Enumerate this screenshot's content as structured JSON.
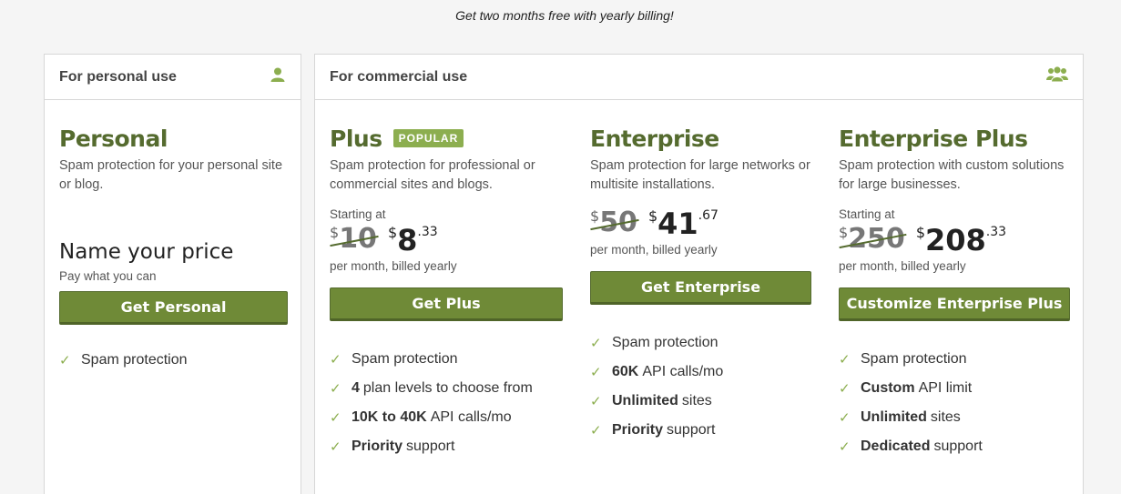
{
  "promo": "Get two months free with yearly billing!",
  "personal_panel": {
    "title": "For personal use",
    "icon": "user-icon",
    "plan": {
      "name": "Personal",
      "description": "Spam protection for your personal site or blog.",
      "price_title": "Name your price",
      "price_sub": "Pay what you can",
      "button": "Get Personal",
      "features": [
        {
          "bold": "",
          "text": "Spam protection"
        }
      ]
    }
  },
  "commercial_panel": {
    "title": "For commercial use",
    "icon": "users-icon",
    "plans": [
      {
        "name": "Plus",
        "badge": "POPULAR",
        "description": "Spam protection for professional or commercial sites and blogs.",
        "starting": "Starting at",
        "old_currency": "$",
        "old_price": "10",
        "currency": "$",
        "price": "8",
        "cents": ".33",
        "billing": "per month, billed yearly",
        "button": "Get Plus",
        "features": [
          {
            "bold": "",
            "text": "Spam protection"
          },
          {
            "bold": "4",
            "text": "plan levels to choose from"
          },
          {
            "bold": "10K to 40K",
            "text": "API calls/mo"
          },
          {
            "bold": "Priority",
            "text": "support"
          }
        ]
      },
      {
        "name": "Enterprise",
        "badge": "",
        "description": "Spam protection for large networks or multisite installations.",
        "starting": "",
        "old_currency": "$",
        "old_price": "50",
        "currency": "$",
        "price": "41",
        "cents": ".67",
        "billing": "per month, billed yearly",
        "button": "Get Enterprise",
        "features": [
          {
            "bold": "",
            "text": "Spam protection"
          },
          {
            "bold": "60K",
            "text": "API calls/mo"
          },
          {
            "bold": "Unlimited",
            "text": "sites"
          },
          {
            "bold": "Priority",
            "text": "support"
          }
        ]
      },
      {
        "name": "Enterprise Plus",
        "badge": "",
        "description": "Spam protection with custom solutions for large businesses.",
        "starting": "Starting at",
        "old_currency": "$",
        "old_price": "250",
        "currency": "$",
        "price": "208",
        "cents": ".33",
        "billing": "per month, billed yearly",
        "button": "Customize Enterprise Plus",
        "features": [
          {
            "bold": "",
            "text": "Spam protection"
          },
          {
            "bold": "Custom",
            "text": "API limit"
          },
          {
            "bold": "Unlimited",
            "text": "sites"
          },
          {
            "bold": "Dedicated",
            "text": "support"
          }
        ]
      }
    ]
  },
  "colors": {
    "accent": "#556b2f",
    "button": "#6f8a37",
    "check": "#8cae4f"
  }
}
